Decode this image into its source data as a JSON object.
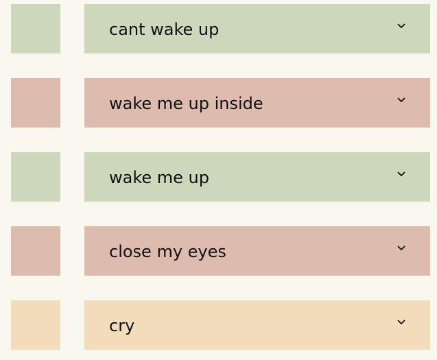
{
  "colors": {
    "background": "#faf7ef",
    "green": "#cdd7bc",
    "pink": "#debbaf",
    "peach": "#f3dcbc"
  },
  "items": [
    {
      "label": "cant wake up",
      "color": "#cdd7bc",
      "icon": "chevron-down-icon"
    },
    {
      "label": "wake me up inside",
      "color": "#debbaf",
      "icon": "chevron-down-icon"
    },
    {
      "label": "wake me up",
      "color": "#cdd7bc",
      "icon": "chevron-down-icon"
    },
    {
      "label": "close my eyes",
      "color": "#debbaf",
      "icon": "chevron-down-icon"
    },
    {
      "label": "cry",
      "color": "#f3dcbc",
      "icon": "chevron-down-icon"
    }
  ]
}
